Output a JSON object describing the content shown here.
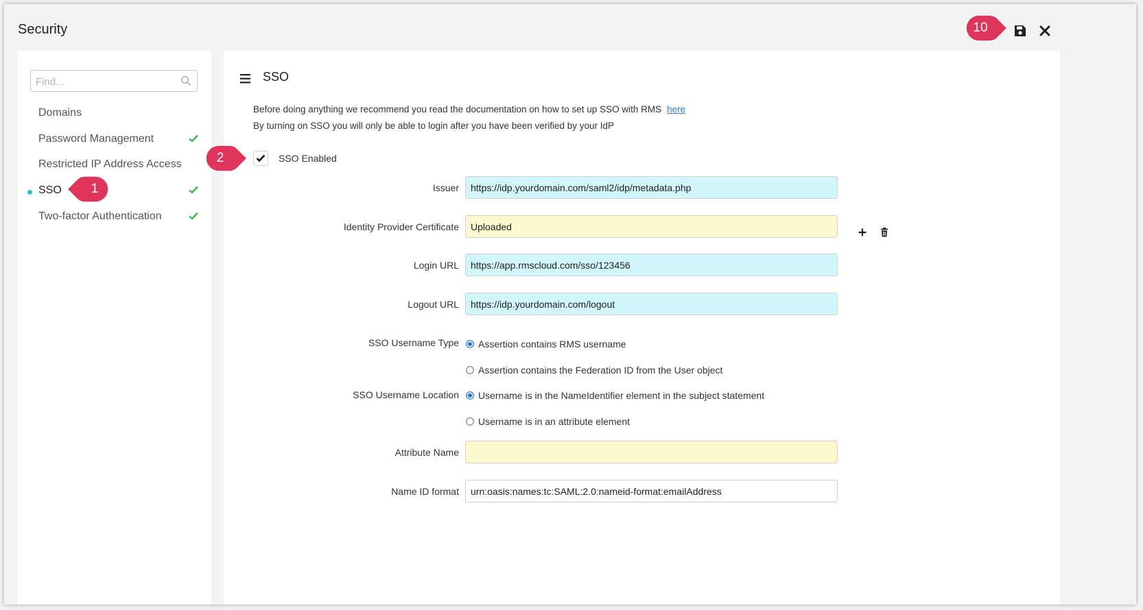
{
  "window": {
    "title": "Security",
    "save_icon": "save-icon",
    "close_icon": "close-icon"
  },
  "callouts": [
    "1",
    "2",
    "10"
  ],
  "accent_color": "#e0355a",
  "sidebar": {
    "search_placeholder": "Find...",
    "items": [
      {
        "label": "Domains",
        "checked": false,
        "active": false
      },
      {
        "label": "Password Management",
        "checked": true,
        "active": false
      },
      {
        "label": "Restricted IP Address Access",
        "checked": false,
        "active": false
      },
      {
        "label": "SSO",
        "checked": true,
        "active": true
      },
      {
        "label": "Two-factor Authentication",
        "checked": true,
        "active": false
      }
    ]
  },
  "main": {
    "title": "SSO",
    "intro_line1": "Before doing anything we recommend you read the documentation on how to set up SSO with RMS",
    "intro_link": "here",
    "intro_line2": "By turning on SSO you will only be able to login after you have been verified by your IdP",
    "sso_enabled_label": "SSO Enabled",
    "sso_enabled": true,
    "fields": {
      "issuer": {
        "label": "Issuer",
        "value": "https://idp.yourdomain.com/saml2/idp/metadata.php"
      },
      "certificate": {
        "label": "Identity Provider Certificate",
        "value": "Uploaded"
      },
      "login_url": {
        "label": "Login URL",
        "value": "https://app.rmscloud.com/sso/123456"
      },
      "logout_url": {
        "label": "Logout URL",
        "value": "https://idp.yourdomain.com/logout"
      },
      "attribute_name": {
        "label": "Attribute Name",
        "value": ""
      },
      "name_id_format": {
        "label": "Name ID format",
        "value": "urn:oasis:names:tc:SAML:2.0:nameid-format:emailAddress"
      }
    },
    "username_type": {
      "label": "SSO Username Type",
      "options": [
        "Assertion contains RMS username",
        "Assertion contains the Federation ID from the User object"
      ],
      "selected": 0
    },
    "username_location": {
      "label": "SSO Username Location",
      "options": [
        "Username is in the NameIdentifier element in the subject statement",
        "Username is in an attribute element"
      ],
      "selected": 0
    }
  }
}
